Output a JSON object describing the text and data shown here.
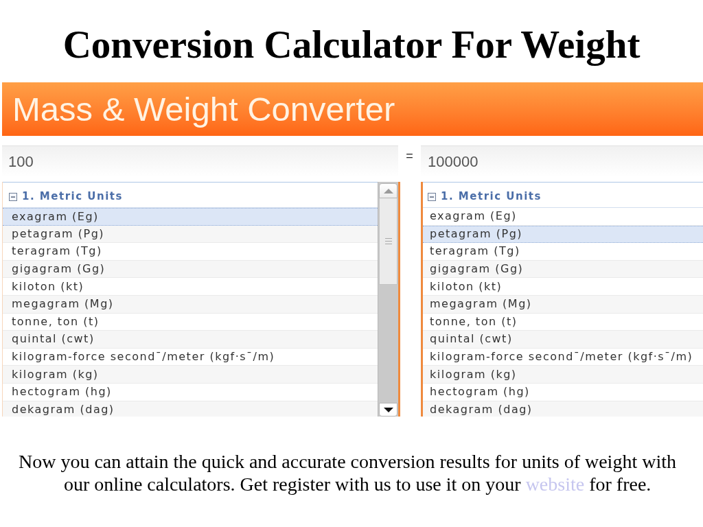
{
  "title": "Conversion Calculator For Weight",
  "converter": {
    "header": "Mass & Weight Converter",
    "equals": "=",
    "panels": [
      {
        "value": "100",
        "scrollbar": true,
        "groups": [
          {
            "label": "1. Metric Units",
            "expanded": true,
            "units": [
              {
                "label": "exagram (Eg)",
                "selected": true
              },
              {
                "label": "petagram (Pg)",
                "selected": false
              },
              {
                "label": "teragram (Tg)",
                "selected": false
              },
              {
                "label": "gigagram (Gg)",
                "selected": false
              },
              {
                "label": "kiloton (kt)",
                "selected": false
              },
              {
                "label": "megagram (Mg)",
                "selected": false
              },
              {
                "label": "tonne, ton (t)",
                "selected": false
              },
              {
                "label": "quintal (cwt)",
                "selected": false
              },
              {
                "label": "kilogram-force second¯/meter (kgf·s¯/m)",
                "selected": false
              },
              {
                "label": "kilogram (kg)",
                "selected": false
              },
              {
                "label": "hectogram (hg)",
                "selected": false
              },
              {
                "label": "dekagram (dag)",
                "selected": false
              }
            ]
          }
        ]
      },
      {
        "value": "100000",
        "groups": [
          {
            "label": "1. Metric Units",
            "expanded": true,
            "units": [
              {
                "label": "exagram (Eg)",
                "selected": false
              },
              {
                "label": "petagram (Pg)",
                "selected": true
              },
              {
                "label": "teragram (Tg)",
                "selected": false
              },
              {
                "label": "gigagram (Gg)",
                "selected": false
              },
              {
                "label": "kiloton (kt)",
                "selected": false
              },
              {
                "label": "megagram (Mg)",
                "selected": false
              },
              {
                "label": "tonne, ton (t)",
                "selected": false
              },
              {
                "label": "quintal (cwt)",
                "selected": false
              },
              {
                "label": "kilogram-force second¯/meter (kgf·s¯/m)",
                "selected": false
              },
              {
                "label": "kilogram (kg)",
                "selected": false
              },
              {
                "label": "hectogram (hg)",
                "selected": false
              },
              {
                "label": "dekagram (dag)",
                "selected": false
              }
            ]
          }
        ]
      }
    ]
  },
  "description": {
    "text_before": "Now you can attain the quick and accurate conversion results for units of weight with our online calculators. Get register with us to use it on your",
    "link": "website",
    "text_after": "for free."
  }
}
